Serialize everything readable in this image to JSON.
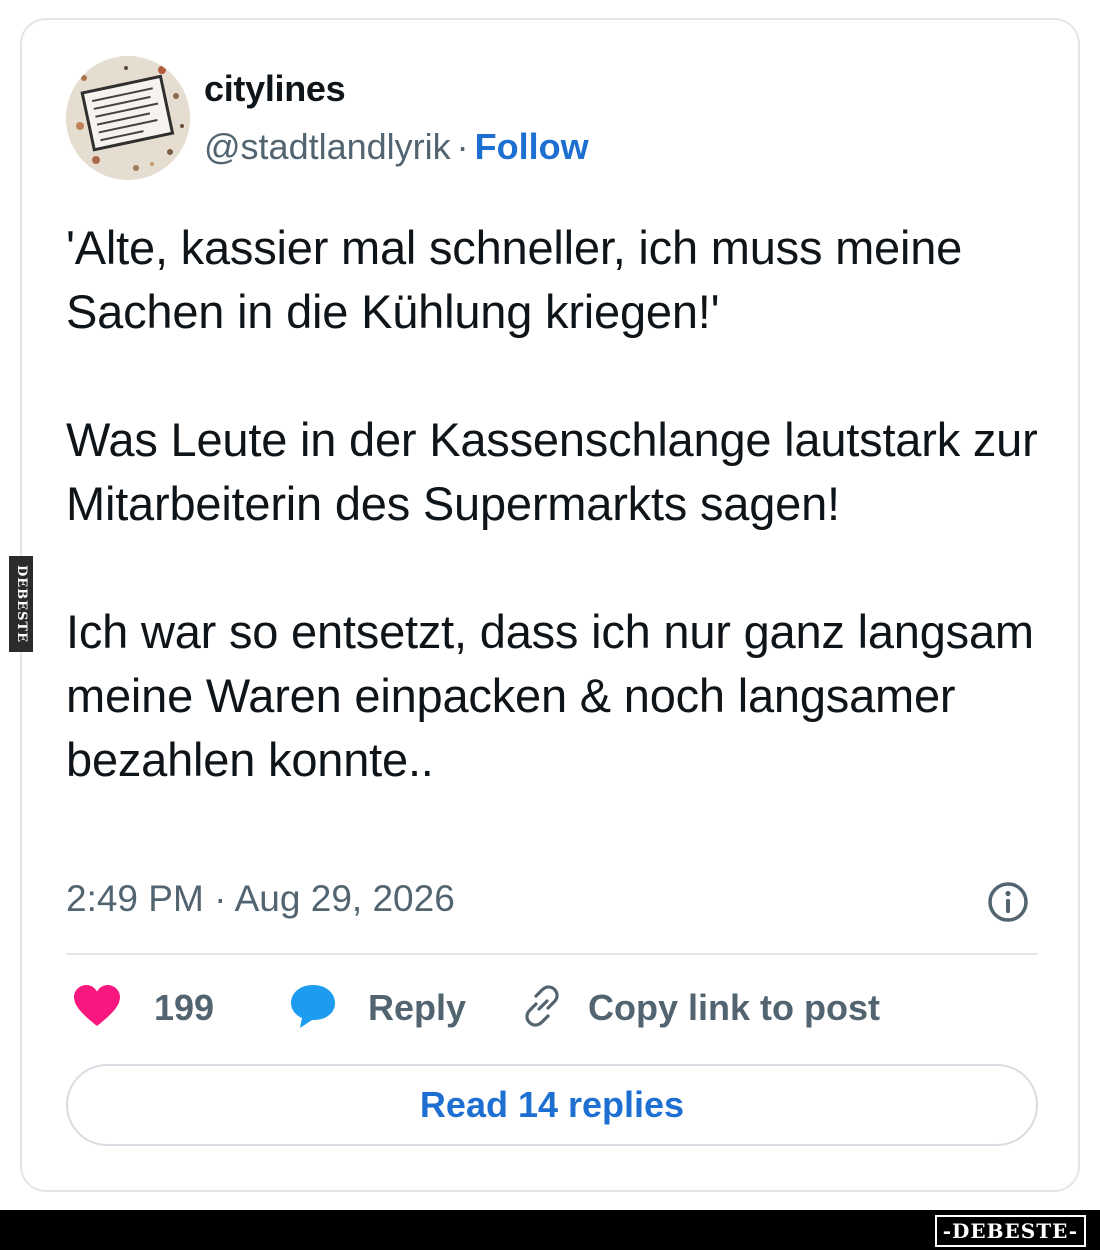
{
  "author": {
    "display_name": "citylines",
    "handle": "@stadtlandlyrik",
    "separator": "·",
    "follow_label": "Follow"
  },
  "tweet": {
    "paragraphs": [
      "'Alte, kassier mal schneller, ich muss meine Sachen in die Kühlung kriegen!'",
      "Was Leute in der Kassenschlange lautstark zur Mitarbeiterin des Supermarkts sagen!",
      "Ich war so entsetzt, dass ich nur ganz langsam meine Waren einpacken & noch langsamer bezahlen konnte.."
    ],
    "timestamp": "2:49 PM · Aug 29, 2026"
  },
  "actions": {
    "like_count": "199",
    "reply_label": "Reply",
    "copy_link_label": "Copy link to post",
    "read_replies_label": "Read 14 replies"
  },
  "icons": {
    "like": "heart-icon",
    "reply": "speech-bubble-icon",
    "copy": "link-icon",
    "info": "info-icon"
  },
  "colors": {
    "link_blue": "#1d6fd1",
    "heart": "#f91880",
    "reply_bubble": "#1d9bf0",
    "muted_text": "#536471"
  },
  "watermark": {
    "side_text": "DEBESTE",
    "footer_text": "-DEBESTE-"
  }
}
